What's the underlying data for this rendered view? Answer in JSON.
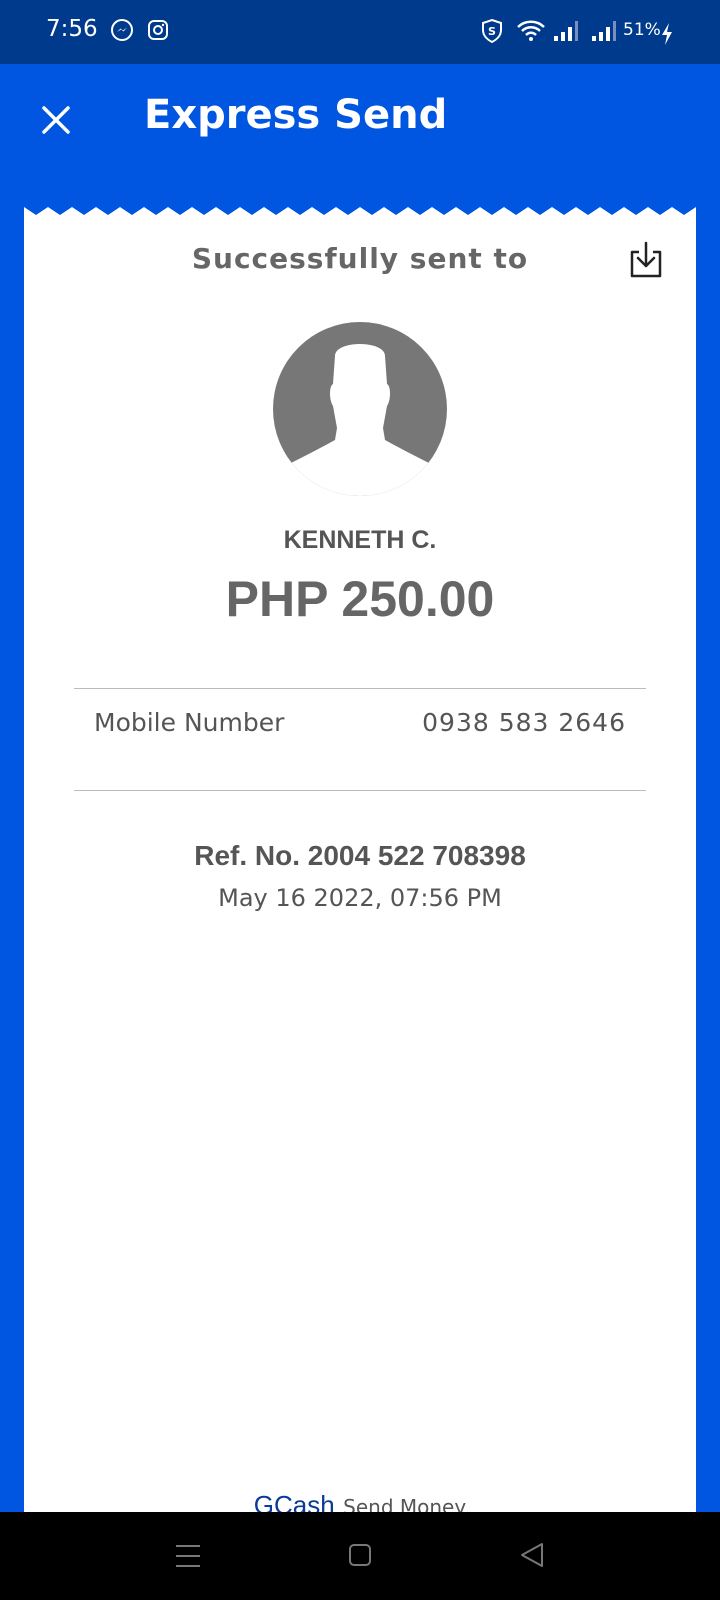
{
  "status_bar": {
    "time": "7:56",
    "battery": "51%",
    "icons": [
      "messenger-icon",
      "instagram-icon",
      "shield-icon",
      "wifi-icon",
      "signal-icon",
      "signal-icon",
      "charging-icon"
    ]
  },
  "header": {
    "title": "Express Send",
    "close_icon": "close-icon"
  },
  "receipt": {
    "heading": "Successfully sent to",
    "download_icon": "download-icon",
    "recipient_name": "KENNETH C.",
    "amount": "PHP 250.00",
    "details": [
      {
        "label": "Mobile Number",
        "value": "0938 583 2646"
      }
    ],
    "reference": "Ref. No. 2004 522 708398",
    "datetime": "May 16 2022, 07:56 PM",
    "footer": {
      "brand": "GCash",
      "caption": "Send Money"
    }
  },
  "nav_bar": {
    "items": [
      "menu-icon",
      "home-icon",
      "back-icon"
    ]
  },
  "colors": {
    "brand_blue": "#0056e0",
    "status_blue": "#003a8c",
    "text_gray": "#666666"
  }
}
